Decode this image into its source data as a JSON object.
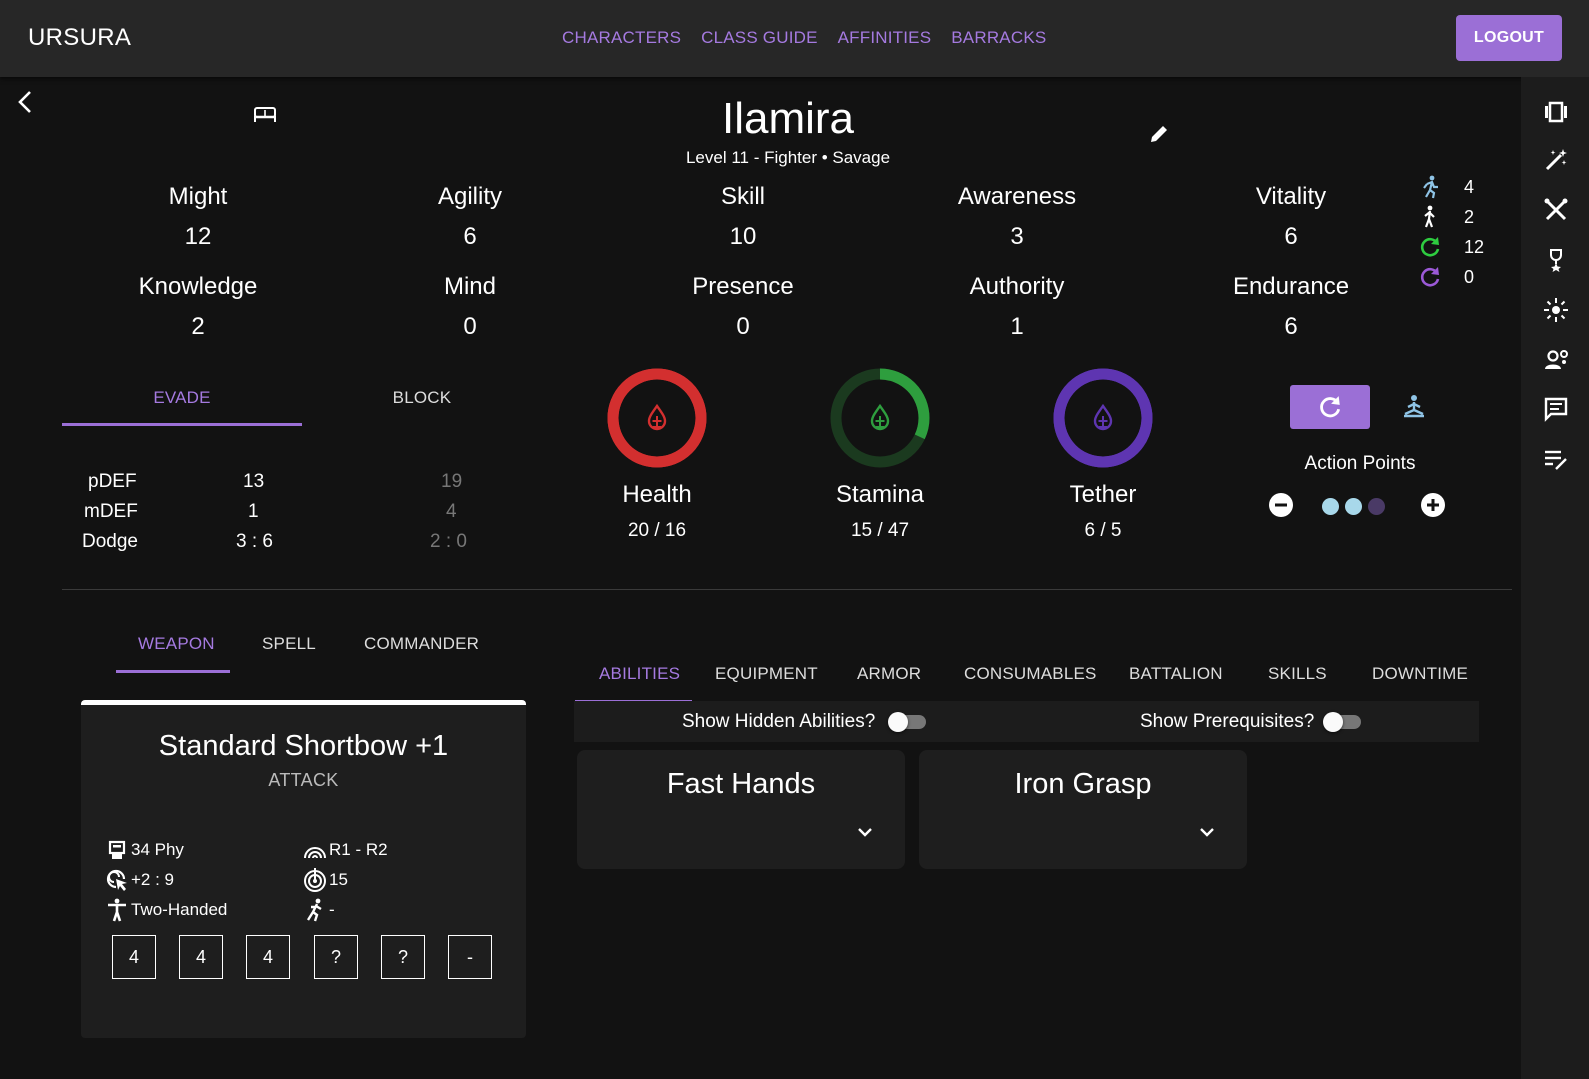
{
  "app": {
    "brand": "URSURA",
    "logout": "LOGOUT"
  },
  "nav": [
    "CHARACTERS",
    "CLASS GUIDE",
    "AFFINITIES",
    "BARRACKS"
  ],
  "character": {
    "name": "Ilamira",
    "subtitle": "Level 11 - Fighter • Savage"
  },
  "attributes": [
    {
      "label": "Might",
      "value": "12"
    },
    {
      "label": "Agility",
      "value": "6"
    },
    {
      "label": "Skill",
      "value": "10"
    },
    {
      "label": "Awareness",
      "value": "3"
    },
    {
      "label": "Vitality",
      "value": "6"
    },
    {
      "label": "Knowledge",
      "value": "2"
    },
    {
      "label": "Mind",
      "value": "0"
    },
    {
      "label": "Presence",
      "value": "0"
    },
    {
      "label": "Authority",
      "value": "1"
    },
    {
      "label": "Endurance",
      "value": "6"
    }
  ],
  "movement": [
    {
      "icon": "run-icon",
      "value": "4",
      "color": "#8fc4e6"
    },
    {
      "icon": "walk-icon",
      "value": "2",
      "color": "#ffffff"
    },
    {
      "icon": "refresh-green-icon",
      "value": "12",
      "color": "#2ecc40"
    },
    {
      "icon": "refresh-purple-icon",
      "value": "0",
      "color": "#9b59d6"
    }
  ],
  "defense": {
    "tabs": [
      "EVADE",
      "BLOCK"
    ],
    "rows": [
      {
        "label": "pDEF",
        "evade": "13",
        "block": "19"
      },
      {
        "label": "mDEF",
        "evade": "1",
        "block": "4"
      },
      {
        "label": "Dodge",
        "evade": "3 : 6",
        "block": "2 : 0"
      }
    ]
  },
  "resources": [
    {
      "label": "Health",
      "value": "20 / 16",
      "color": "#d32f2f",
      "track": "#d32f2f",
      "fill": 1.0
    },
    {
      "label": "Stamina",
      "value": "15 / 47",
      "color": "#2e9e3e",
      "track": "#1b3a1f",
      "fill": 0.32
    },
    {
      "label": "Tether",
      "value": "6 / 5",
      "color": "#5e35b1",
      "track": "#5e35b1",
      "fill": 1.0
    }
  ],
  "action_points": {
    "label": "Action Points",
    "filled": 2,
    "total": 3,
    "color_on": "#a8d8ea",
    "color_off": "#4a3a66"
  },
  "combat_tabs": [
    "WEAPON",
    "SPELL",
    "COMMANDER"
  ],
  "main_tabs": [
    "ABILITIES",
    "EQUIPMENT",
    "ARMOR",
    "CONSUMABLES",
    "BATTALION",
    "SKILLS",
    "DOWNTIME"
  ],
  "weapon": {
    "name": "Standard Shortbow +1",
    "type": "ATTACK",
    "damage": "34 Phy",
    "range": "R1 - R2",
    "accuracy": "+2 : 9",
    "crit": "15",
    "hands": "Two-Handed",
    "special": "-",
    "boxes": [
      "4",
      "4",
      "4",
      "?",
      "?",
      "-"
    ]
  },
  "filters": {
    "hidden": "Show Hidden Abilities?",
    "prereq": "Show Prerequisites?"
  },
  "abilities": [
    "Fast Hands",
    "Iron Grasp"
  ],
  "accent": "#9b6fd6"
}
